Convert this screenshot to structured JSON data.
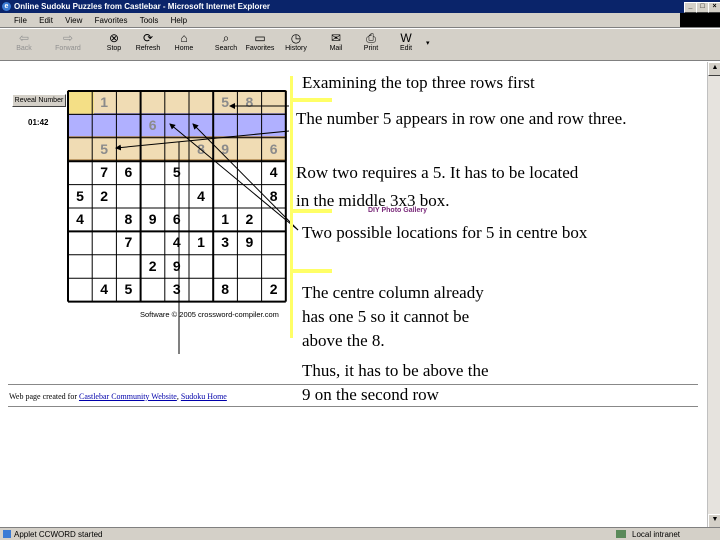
{
  "window": {
    "title": "Online Sudoku Puzzles from Castlebar - Microsoft Internet Explorer"
  },
  "menu": [
    "File",
    "Edit",
    "View",
    "Favorites",
    "Tools",
    "Help"
  ],
  "toolbar": {
    "back": "Back",
    "forward": "Forward",
    "stop": "Stop",
    "refresh": "Refresh",
    "home": "Home",
    "search": "Search",
    "favorites": "Favorites",
    "history": "History",
    "mail": "Mail",
    "print": "Print",
    "edit": "Edit"
  },
  "puzzle": {
    "reveal_button": "Reveal Number",
    "timer": "01:42",
    "rows": [
      [
        "",
        "1",
        "",
        "",
        "",
        "",
        "5",
        "8",
        ""
      ],
      [
        "",
        "",
        "",
        "6",
        "",
        "",
        "",
        "",
        ""
      ],
      [
        "",
        "5",
        "",
        "",
        "",
        "8",
        "9",
        "",
        "6"
      ],
      [
        "",
        "7",
        "6",
        "",
        "5",
        "",
        "",
        "",
        "4"
      ],
      [
        "5",
        "2",
        "",
        "",
        "",
        "4",
        "",
        "",
        "8"
      ],
      [
        "4",
        "",
        "8",
        "9",
        "6",
        "",
        "1",
        "2",
        ""
      ],
      [
        "",
        "",
        "7",
        "",
        "4",
        "1",
        "3",
        "9",
        ""
      ],
      [
        "",
        "",
        "",
        "2",
        "9",
        "",
        "",
        "",
        ""
      ],
      [
        "",
        "4",
        "5",
        "",
        "3",
        "",
        "8",
        "",
        "2"
      ]
    ],
    "copyright": "Software © 2005 crossword-compiler.com"
  },
  "behind_text": "DIY Photo Gallery",
  "annotations": [
    "Examining the top three rows first",
    "The number 5 appears in row one and row three.",
    "Row two requires a 5. It has to be located in the middle 3x3 box.",
    "Two possible locations for 5 in centre box",
    "The centre column already has one 5 so it cannot be above the 8.",
    "Thus, it has to be above the 9 on the second row"
  ],
  "footer": {
    "prefix": "Web page created for",
    "link1": "Castlebar Community Website",
    "link2": "Sudoku Home"
  },
  "status": {
    "left": "Applet CCWORD started",
    "right": "Local intranet"
  },
  "colors": {
    "band_row1": "#f0dcb4",
    "band_row2": "#b0b0ff",
    "band_row3": "#f0dcb4",
    "highlight": "#ffff66",
    "titlebar": "#0a246a"
  }
}
